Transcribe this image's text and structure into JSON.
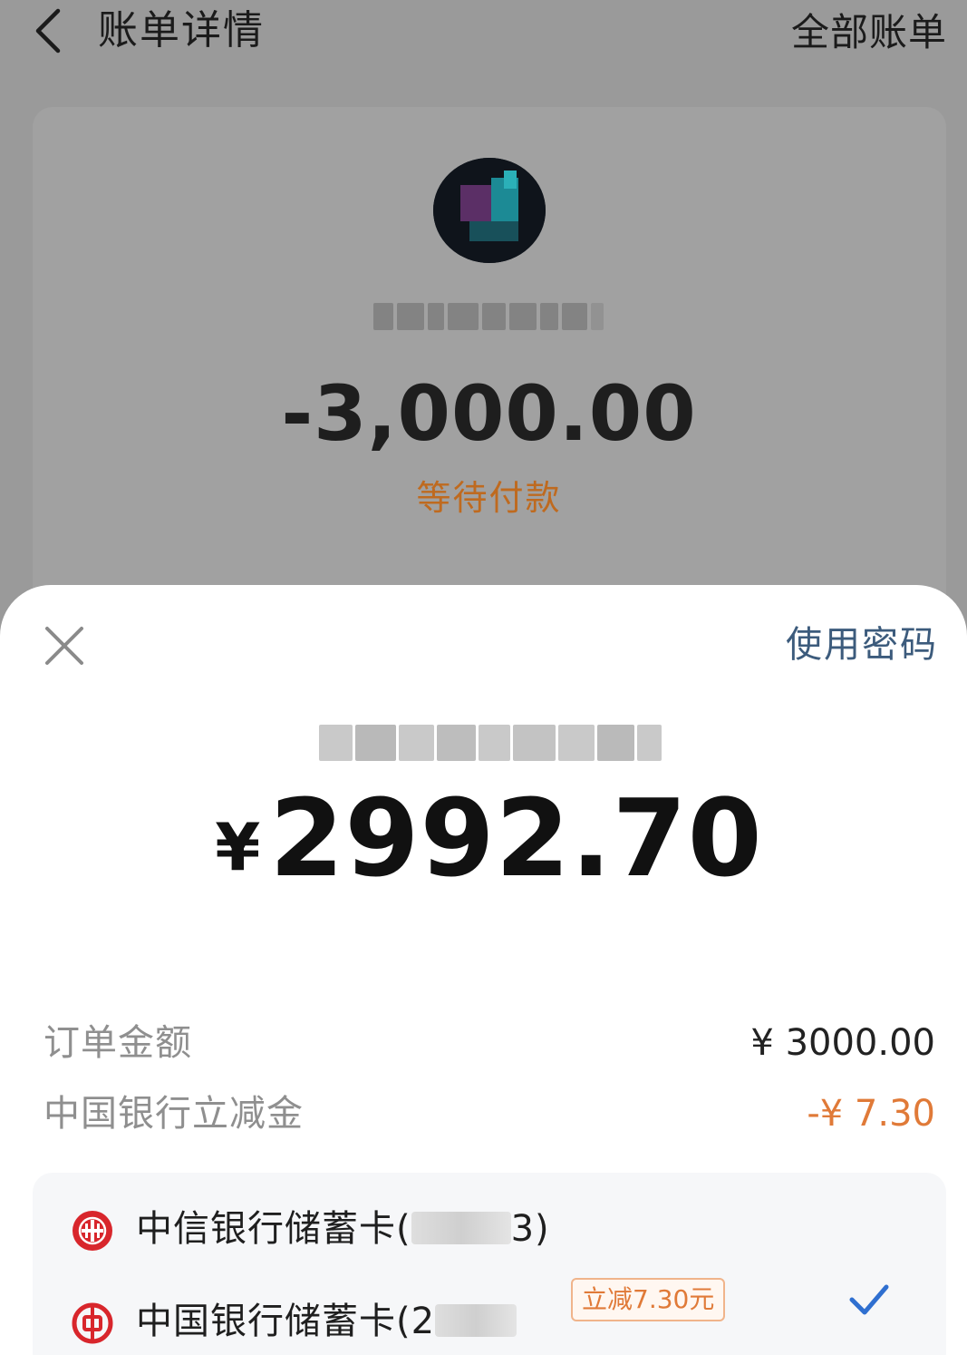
{
  "topbar": {
    "title": "账单详情",
    "right_action": "全部账单"
  },
  "bill": {
    "amount": "-3,000.00",
    "status": "等待付款"
  },
  "pay_sheet": {
    "use_password_label": "使用密码",
    "currency_symbol": "¥",
    "amount": "2992.70",
    "details": [
      {
        "label": "订单金额",
        "value": "¥ 3000.00"
      },
      {
        "label": "中国银行立减金",
        "value": "-¥ 7.30"
      }
    ],
    "methods": [
      {
        "name": "中信银行储蓄卡",
        "open_paren": "(",
        "close_paren": "3)",
        "icon": "citic-bank-logo-icon",
        "selected": false
      },
      {
        "name": "中国银行储蓄卡",
        "open_paren": "(2",
        "close_paren": "",
        "icon": "boc-bank-logo-icon",
        "badge": "立减7.30元",
        "selected": true
      }
    ]
  },
  "colors": {
    "overlay_bg": "#9a9a9a",
    "status_orange": "#bf6a1f",
    "discount_orange": "#e07a38",
    "link_blue": "#3c5b7c",
    "check_blue": "#2f6fd0",
    "bank_red": "#d8262c"
  }
}
